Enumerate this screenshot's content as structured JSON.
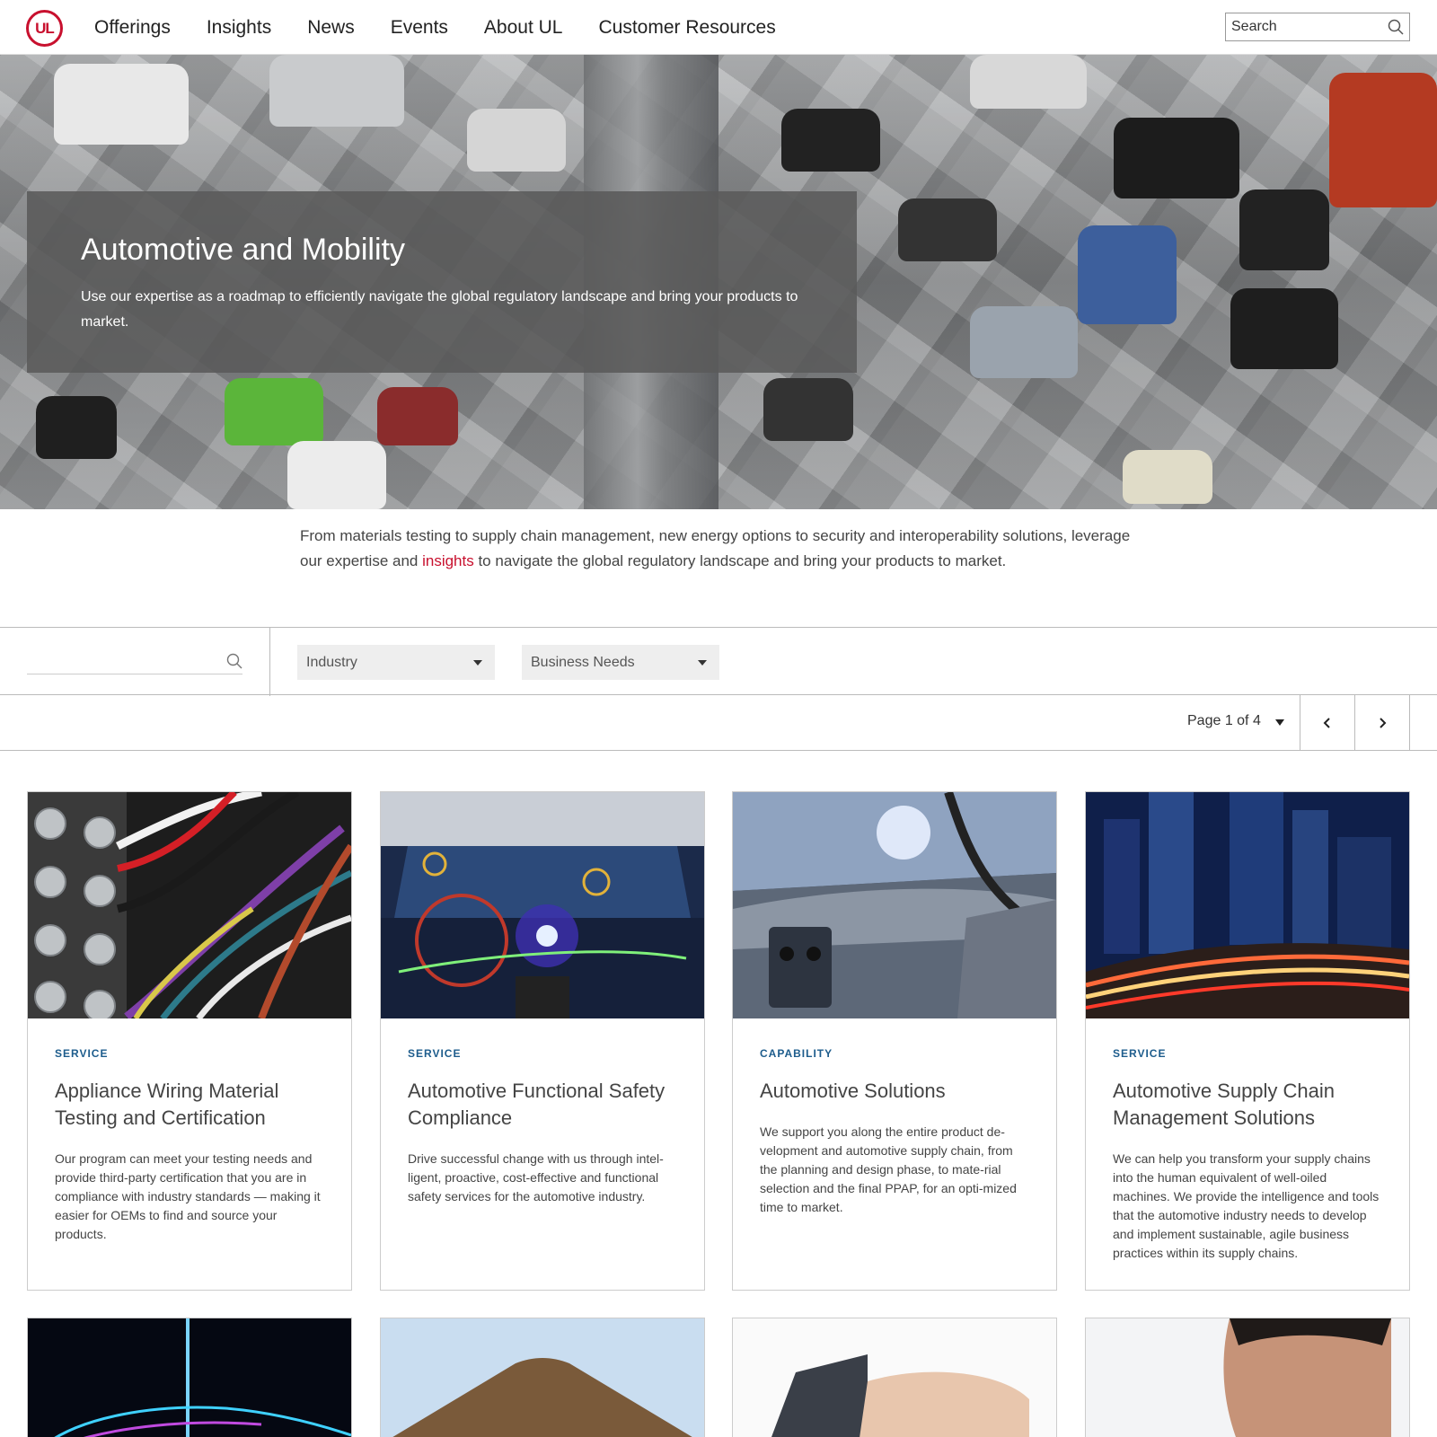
{
  "header": {
    "logo_text": "UL",
    "nav": [
      "Offerings",
      "Insights",
      "News",
      "Events",
      "About UL",
      "Customer Resources"
    ],
    "search_placeholder": "Search"
  },
  "hero": {
    "title": "Automotive and Mobility",
    "subtitle": "Use our expertise as a roadmap to efficiently navigate the global regulatory landscape and bring your products to market."
  },
  "intro": {
    "before_link": "From materials testing to supply chain management, new energy options to security and interoperability solutions, leverage our expertise and ",
    "link": "insights",
    "after_link": " to navigate the global regulatory landscape and bring your products to market."
  },
  "filters": {
    "industry": "Industry",
    "business_needs": "Business Needs"
  },
  "pager": {
    "label": "Page 1 of 4"
  },
  "cards": [
    {
      "tag": "SERVICE",
      "title": "Appliance Wiring Material Testing and Certification",
      "desc": "Our program can meet your testing needs and provide third-party certification that you are in compliance with industry standards — making it easier for OEMs to find and source your products."
    },
    {
      "tag": "SERVICE",
      "title": "Automotive Functional Safety Compliance",
      "desc": "Drive successful change with us through intel-ligent, proactive, cost-effective and functional safety services for the automotive industry."
    },
    {
      "tag": "CAPABILITY",
      "title": "Automotive Solutions",
      "desc": "We support you along the entire product de-velopment and automotive supply chain, from the planning and design phase, to mate-rial selection and the final PPAP, for an opti-mized time to market."
    },
    {
      "tag": "SERVICE",
      "title": "Automotive Supply Chain Management Solutions",
      "desc": "We can help you transform your supply chains into the human equivalent of well-oiled machines. We provide the intelligence and tools that the automotive industry needs to develop and implement sustainable, agile business practices within its supply chains."
    }
  ],
  "colors": {
    "brand_red": "#c8102e",
    "tag_blue": "#1d5c8c"
  }
}
